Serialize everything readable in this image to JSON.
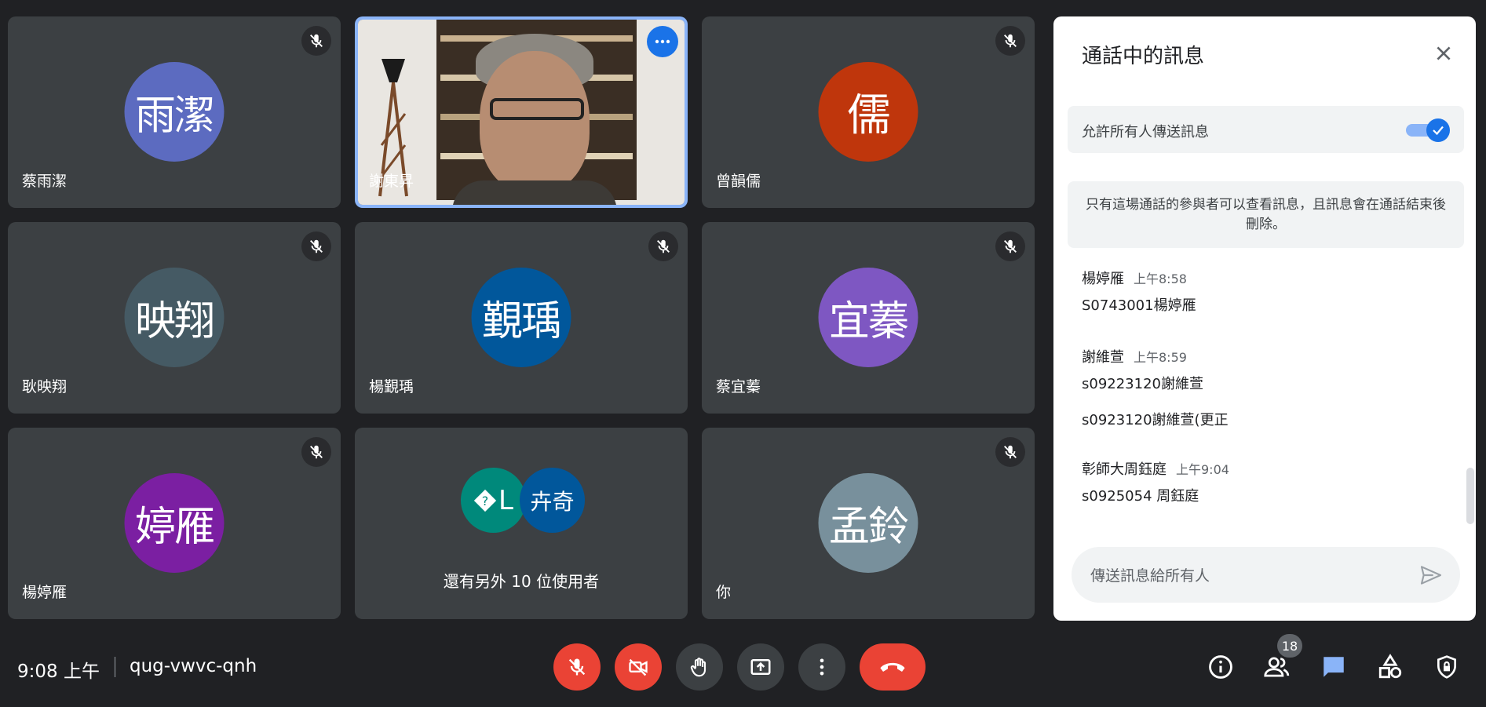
{
  "tiles": [
    {
      "name": "蔡雨潔",
      "avatar_text": "雨潔",
      "avatar_color": "#5c6bc0",
      "muted": true
    },
    {
      "name": "謝東昇",
      "video": true,
      "more_button": true
    },
    {
      "name": "曾韻儒",
      "avatar_text": "儒",
      "avatar_color": "#bf360c",
      "muted": true
    },
    {
      "name": "耿映翔",
      "avatar_text": "映翔",
      "avatar_color": "#455a64",
      "muted": true
    },
    {
      "name": "楊覲瑀",
      "avatar_text": "覲瑀",
      "avatar_color": "#01579b",
      "muted": true
    },
    {
      "name": "蔡宜蓁",
      "avatar_text": "宜蓁",
      "avatar_color": "#7e57c2",
      "muted": true
    },
    {
      "name": "楊婷雁",
      "avatar_text": "婷雁",
      "avatar_color": "#7b1fa2",
      "muted": true
    },
    {
      "more_label": "還有另外 10 位使用者",
      "mini_avatars": [
        {
          "text": "L",
          "color": "#00897b"
        },
        {
          "text": "卉奇",
          "color": "#01579b"
        }
      ]
    },
    {
      "name": "你",
      "avatar_text": "孟鈴",
      "avatar_color": "#78909c",
      "muted": true
    }
  ],
  "chat": {
    "title": "通話中的訊息",
    "allow_label": "允許所有人傳送訊息",
    "allow_on": true,
    "notice": "只有這場通話的參與者可以查看訊息，且訊息會在通話結束後刪除。",
    "messages": [
      {
        "sender": "楊婷雁",
        "time": "上午8:58",
        "lines": [
          "S0743001楊婷雁"
        ]
      },
      {
        "sender": "謝維萱",
        "time": "上午8:59",
        "lines": [
          "s09223120謝維萱",
          "s0923120謝維萱(更正"
        ]
      },
      {
        "sender": "彰師大周鈺庭",
        "time": "上午9:04",
        "lines": [
          "s0925054 周鈺庭"
        ]
      }
    ],
    "input_placeholder": "傳送訊息給所有人"
  },
  "bottom": {
    "clock": "9:08 上午",
    "meeting_code": "qug-vwvc-qnh",
    "participants_count": "18"
  },
  "colors": {
    "background": "#202124",
    "tile": "#3c4043",
    "accent": "#1a73e8",
    "danger": "#ea4335"
  },
  "icons": {
    "tile_status": "mic-off-icon",
    "controls": [
      "mic-off-icon",
      "videocam-off-icon",
      "raise-hand-icon",
      "present-screen-icon",
      "more-vert-icon",
      "hang-up-icon"
    ],
    "right_controls": [
      "info-icon",
      "people-icon",
      "chat-icon",
      "activities-icon",
      "host-controls-icon"
    ]
  }
}
